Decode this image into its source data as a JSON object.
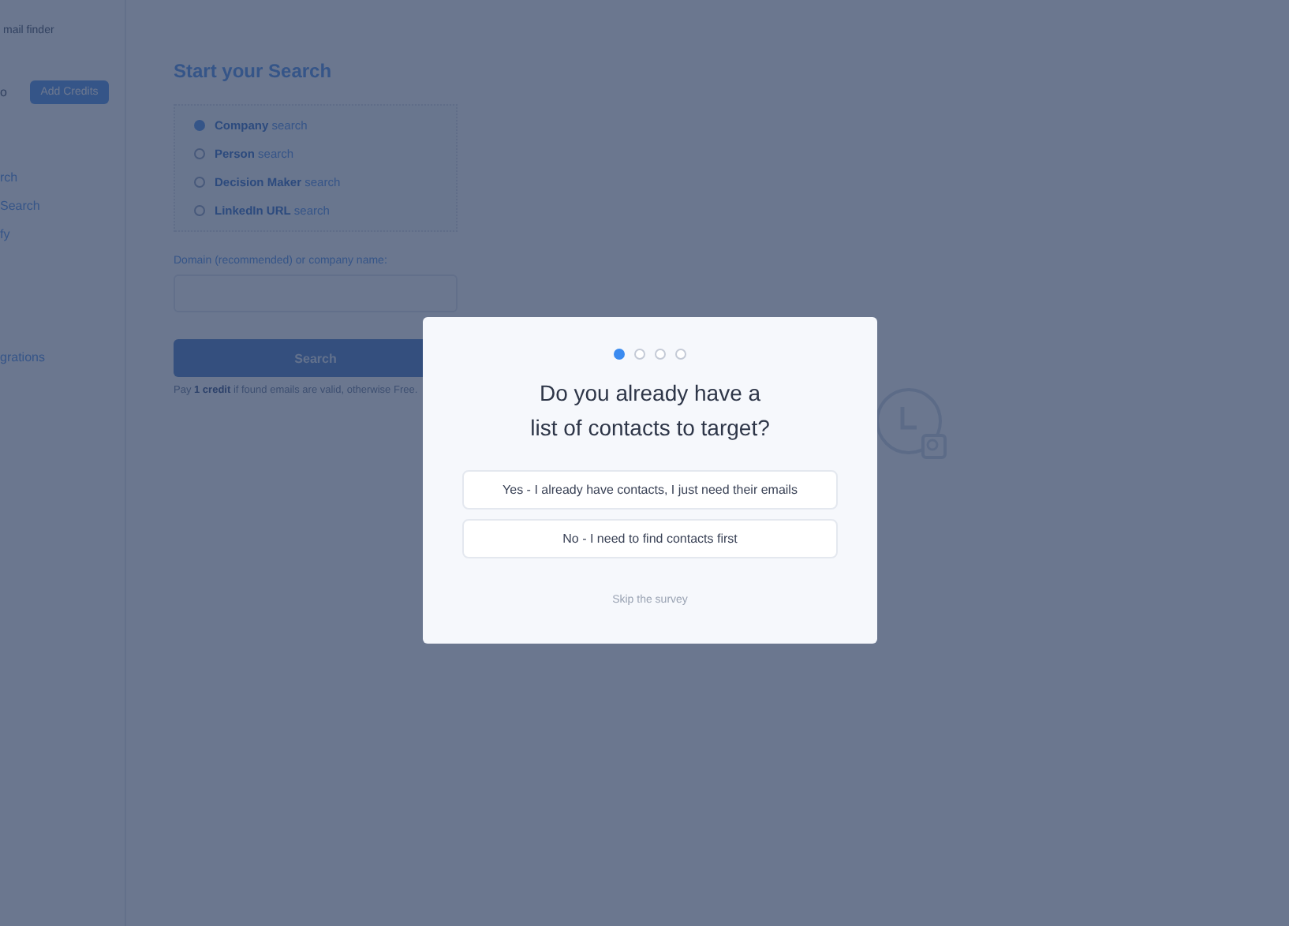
{
  "sidebar": {
    "brand": "mail finder",
    "credits_fragment": "o",
    "add_credits": "Add Credits",
    "items": [
      {
        "label": "rch"
      },
      {
        "label": "Search"
      },
      {
        "label": "fy"
      },
      {
        "label": "grations"
      }
    ]
  },
  "search_panel": {
    "title": "Start your Search",
    "search_types": [
      {
        "bold": "Company",
        "rest": "search",
        "selected": true
      },
      {
        "bold": "Person",
        "rest": "search",
        "selected": false
      },
      {
        "bold": "Decision Maker",
        "rest": "search",
        "selected": false
      },
      {
        "bold": "LinkedIn URL",
        "rest": "search",
        "selected": false
      }
    ],
    "field_label": "Domain (recommended) or company name:",
    "button": "Search",
    "note": "Pay **1 credit** if found emails are valid, otherwise Free."
  },
  "survey": {
    "steps": [
      {
        "selected": true
      },
      {
        "selected": false
      },
      {
        "selected": false
      },
      {
        "selected": false
      }
    ],
    "question_lines": [
      "Do you already have a",
      "list of contacts to target?"
    ],
    "options": [
      "Yes - I already have contacts, I just need their emails",
      "No - I need to find contacts first"
    ],
    "skip": "Skip the survey"
  }
}
